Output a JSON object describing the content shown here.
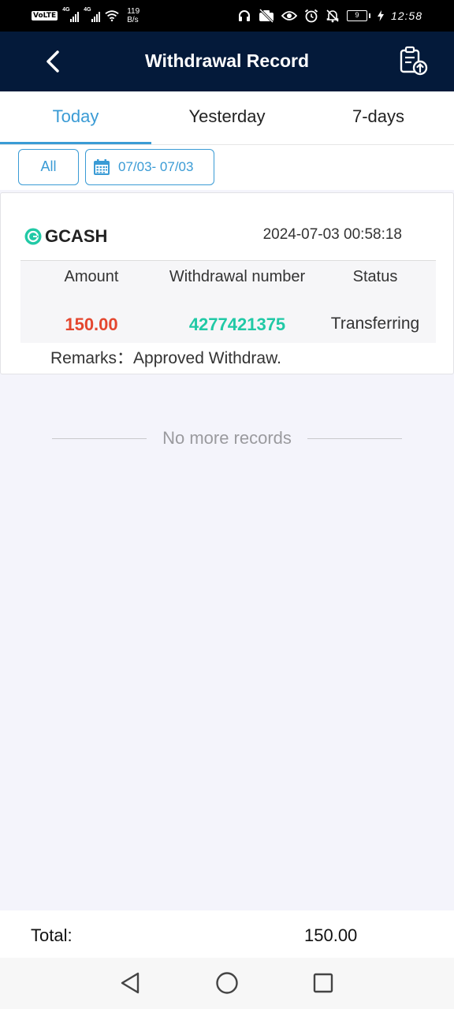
{
  "status_bar": {
    "volte": "VoLTE",
    "sim1_net": "4G",
    "sim2_net": "4G",
    "speed_value": "119",
    "speed_unit": "B/s",
    "battery": "9",
    "time": "12:58",
    "icons": [
      "headphones-icon",
      "camera-off-icon",
      "eye-icon",
      "alarm-icon",
      "bell-off-icon",
      "battery-icon",
      "charging-icon"
    ]
  },
  "header": {
    "title": "Withdrawal Record",
    "back_icon": "chevron-left-icon",
    "action_icon": "clipboard-upload-icon",
    "background": "#041a3a"
  },
  "tabs": [
    {
      "label": "Today",
      "active": true
    },
    {
      "label": "Yesterday",
      "active": false
    },
    {
      "label": "7-days",
      "active": false
    }
  ],
  "filters": {
    "all_label": "All",
    "date_range": "07/03- 07/03",
    "accent": "#3a9bd5"
  },
  "record": {
    "method": "GCASH",
    "datetime": "2024-07-03 00:58:18",
    "headers": {
      "amount": "Amount",
      "number": "Withdrawal number",
      "status": "Status"
    },
    "amount": "150.00",
    "number": "4277421375",
    "status": "Transferring",
    "remarks_label": "Remarks：",
    "remarks": "Approved Withdraw.",
    "amount_color": "#e4472f",
    "number_color": "#21c9a6"
  },
  "list_end": "No more records",
  "total": {
    "label": "Total:",
    "value": "150.00"
  },
  "nav": {
    "icons": [
      "back-triangle-icon",
      "home-circle-icon",
      "recents-square-icon"
    ]
  }
}
